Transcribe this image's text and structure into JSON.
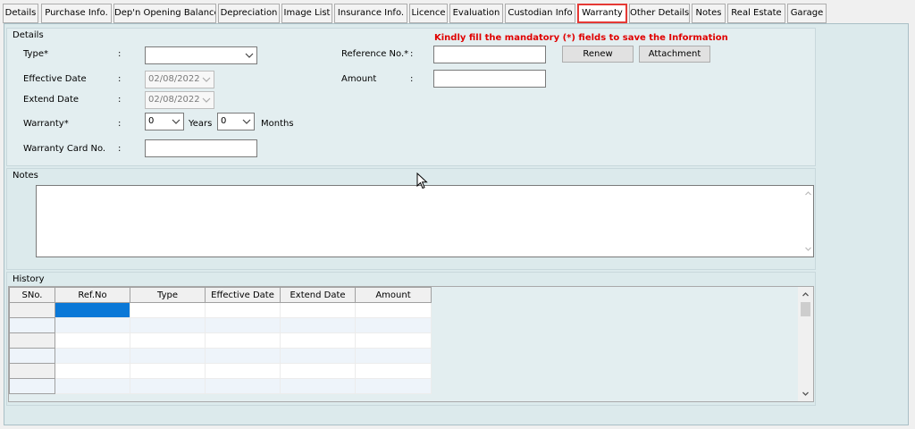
{
  "tabs": [
    {
      "label": "Details"
    },
    {
      "label": "Purchase Info."
    },
    {
      "label": "Dep'n Opening Balance"
    },
    {
      "label": "Depreciation"
    },
    {
      "label": "Image List"
    },
    {
      "label": "Insurance Info."
    },
    {
      "label": "Licence"
    },
    {
      "label": "Evaluation"
    },
    {
      "label": "Custodian Info"
    },
    {
      "label": "Warranty"
    },
    {
      "label": "Other Details"
    },
    {
      "label": "Notes"
    },
    {
      "label": "Real Estate"
    },
    {
      "label": "Garage"
    }
  ],
  "active_tab": "Warranty",
  "details": {
    "title": "Details",
    "mandatory_warning": "Kindly fill the mandatory (*) fields to save the Information",
    "colon": ":",
    "type_label": "Type*",
    "type_value": "",
    "effective_date_label": "Effective Date",
    "effective_date_value": "02/08/2022",
    "extend_date_label": "Extend Date",
    "extend_date_value": "02/08/2022",
    "warranty_label": "Warranty*",
    "warranty_years_value": "0",
    "years_label": "Years",
    "warranty_months_value": "0",
    "months_label": "Months",
    "warranty_card_label": "Warranty Card No.",
    "warranty_card_value": "",
    "reference_label": "Reference No.*",
    "reference_value": "",
    "amount_label": "Amount",
    "amount_value": "",
    "renew_label": "Renew",
    "attachment_label": "Attachment"
  },
  "notes": {
    "title": "Notes",
    "value": ""
  },
  "history": {
    "title": "History",
    "columns": [
      "SNo.",
      "Ref.No",
      "Type",
      "Effective Date",
      "Extend Date",
      "Amount"
    ],
    "rows": []
  },
  "colors": {
    "panel_bg": "#dceaec",
    "warning": "#e00000",
    "active_tab_border": "#e53935",
    "selection": "#0a78d7"
  },
  "icons": [
    "chevron-down-icon",
    "scroll-up-icon",
    "scroll-down-icon",
    "mouse-pointer-icon"
  ]
}
